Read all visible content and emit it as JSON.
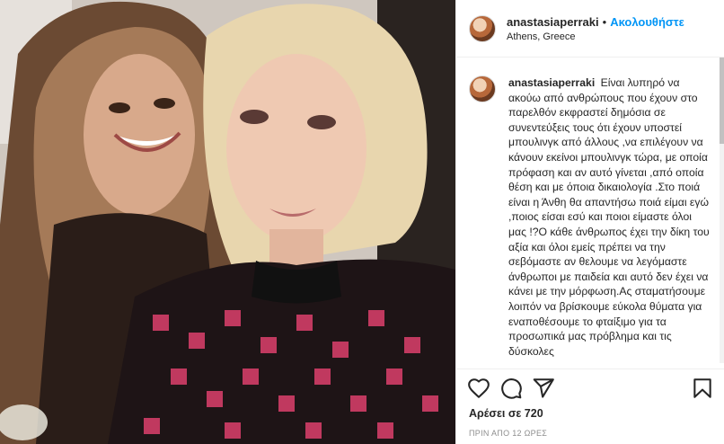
{
  "post": {
    "username": "anastasiaperraki",
    "separator": "•",
    "follow_label": "Ακολουθήστε",
    "location": "Athens, Greece"
  },
  "caption": {
    "username": "anastasiaperraki",
    "text": "Είναι λυπηρό να ακούω από ανθρώπους που έχουν στο παρελθόν εκφραστεί δημόσια σε συνεντεύξεις τους ότι έχουν υποστεί μπουλινγκ από άλλους ,να επιλέγουν να κάνουν εκείνοι μπουλινγκ τώρα, με οποία πρόφαση και αν αυτό γίνεται ,από οποία θέση και με όποια δικαιολογία .Στο ποιά είναι η Άνθη θα απαντήσω ποιά είμαι εγώ ,ποιος είσαι εσύ και ποιοι είμαστε όλοι μας !?Ο κάθε άνθρωπος έχει την δίκη του αξία και όλοι εμείς πρέπει να την σεβόμαστε αν θελουμε να λεγόμαστε άνθρωποι με παιδεία και αυτό δεν έχει να κάνει με την μόρφωση.Ας σταματήσουμε λοιπόν να βρίσκουμε εύκολα θύματα για εναποθέσουμε το φταίξιμο για τα προσωπικά μας πρόβλημα και τις δύσκολες"
  },
  "actions": {
    "like_icon": "heart-icon",
    "comment_icon": "comment-icon",
    "share_icon": "share-icon",
    "save_icon": "bookmark-icon"
  },
  "likes_text": "Αρέσει σε 720",
  "time_text": "ΠΡΙΝ ΑΠΟ 12 ΩΡΕΣ",
  "colors": {
    "accent": "#0095f6",
    "text": "#262626",
    "muted": "#8e8e8e",
    "border": "#efefef"
  }
}
